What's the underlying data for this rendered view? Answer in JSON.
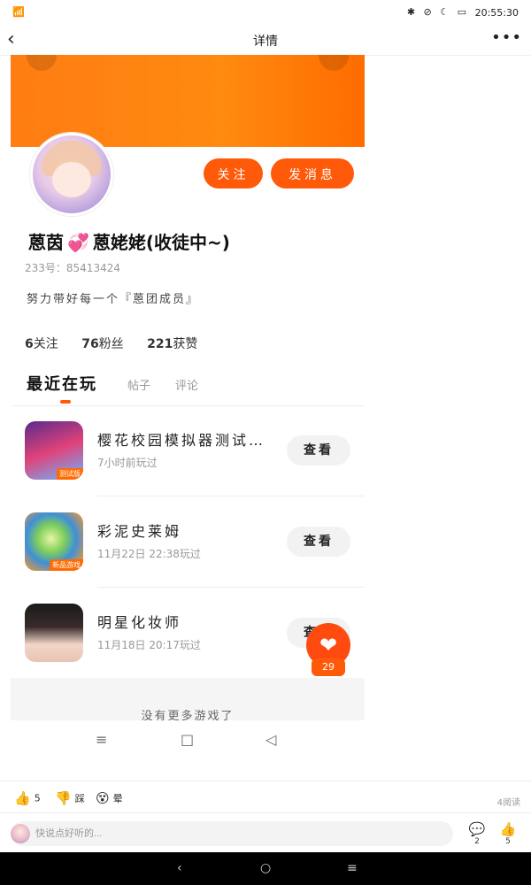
{
  "status_bar": {
    "time": "20:55:30",
    "left_icons": "wifi-icon notification-icon",
    "right_icons": "bluetooth mute dnd battery"
  },
  "nav": {
    "back": "‹",
    "title": "详情",
    "more": "•••"
  },
  "profile": {
    "follow_label": "关注",
    "message_label": "发消息",
    "username_part1": "蒽茵",
    "username_heart": "💞",
    "username_part2": "蒽姥姥(收徒中~)",
    "user_id": "233号：85413424",
    "bio": "努力带好每一个『蒽团成员』",
    "stats": {
      "following_num": "6",
      "following_label": "关注",
      "fans_num": "76",
      "fans_label": "粉丝",
      "likes_num": "221",
      "likes_label": "获赞"
    }
  },
  "tabs": [
    {
      "label": "最近在玩"
    },
    {
      "label": "帖子"
    },
    {
      "label": "评论"
    }
  ],
  "games": [
    {
      "name": "樱花校园模拟器测试…",
      "time": "7小时前玩过",
      "view_label": "查看",
      "icon": "sakura-game-icon",
      "badge": "测试版"
    },
    {
      "name": "彩泥史莱姆",
      "time": "11月22日 22:38玩过",
      "view_label": "查看",
      "icon": "slime-game-icon",
      "badge": "新品游戏"
    },
    {
      "name": "明星化妆师",
      "time": "11月18日 20:17玩过",
      "view_label": "查看",
      "icon": "makeup-game-icon"
    }
  ],
  "favorite": {
    "count": "29",
    "icon": "heart-icon"
  },
  "no_more": "没有更多游戏了",
  "card_nav": {
    "menu": "≡",
    "home": "□",
    "back": "◁"
  },
  "reactions": [
    {
      "icon": "thumbs-up-icon",
      "label": "5"
    },
    {
      "icon": "thumbs-down-icon",
      "label": "踩"
    },
    {
      "icon": "dizzy-face-icon",
      "label": "晕"
    }
  ],
  "read_count": "4阅读",
  "comment": {
    "placeholder": "快说点好听的...",
    "comment_count": "2",
    "like_count": "5"
  },
  "system_nav": {
    "back": "‹",
    "home": "○",
    "menu": "≡"
  },
  "colors": {
    "accent": "#ff5a0a",
    "banner": "#ff7d12"
  }
}
